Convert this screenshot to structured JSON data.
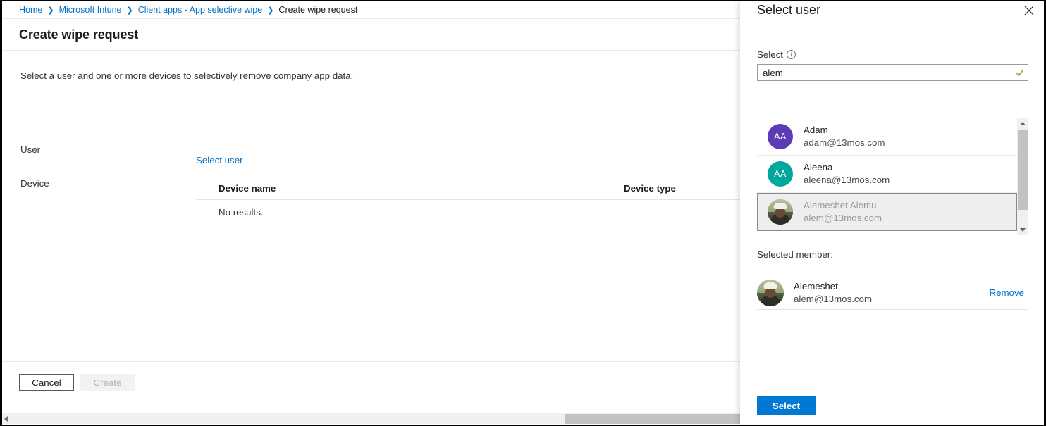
{
  "breadcrumb": {
    "items": [
      {
        "label": "Home",
        "link": true
      },
      {
        "label": "Microsoft Intune",
        "link": true
      },
      {
        "label": "Client apps - App selective wipe",
        "link": true
      },
      {
        "label": "Create wipe request",
        "link": false
      }
    ],
    "separator": "❯"
  },
  "blade": {
    "title": "Create wipe request",
    "intro": "Select a user and one or more devices to selectively remove company app data.",
    "user_label": "User",
    "select_user_link": "Select user",
    "device_label": "Device",
    "table": {
      "columns": [
        "Device name",
        "Device type"
      ],
      "empty_message": "No results."
    },
    "footer": {
      "cancel_label": "Cancel",
      "create_label": "Create"
    }
  },
  "panel": {
    "title": "Select user",
    "close_label": "✕",
    "select_label": "Select",
    "info_glyph": "i",
    "search": {
      "value": "alem",
      "placeholder": "",
      "valid": true
    },
    "results": [
      {
        "name": "Adam",
        "email": "adam@13mos.com",
        "initials": "AA",
        "avatar_type": "initials",
        "avatar_color": "#5c3bb5",
        "selected": false
      },
      {
        "name": "Aleena",
        "email": "aleena@13mos.com",
        "initials": "AA",
        "avatar_type": "initials",
        "avatar_color": "#00a79d",
        "selected": false
      },
      {
        "name": "Alemeshet Alemu",
        "email": "alem@13mos.com",
        "initials": "",
        "avatar_type": "photo",
        "avatar_color": "",
        "selected": true
      }
    ],
    "selected_member_label": "Selected member:",
    "selected_member": {
      "name": "Alemeshet",
      "email": "alem@13mos.com",
      "avatar_type": "photo",
      "remove_label": "Remove"
    },
    "footer": {
      "select_label": "Select"
    }
  },
  "colors": {
    "accent_blue": "#0078d4",
    "link_blue": "#0071c9",
    "valid_green": "#7fba42",
    "avatar_purple": "#5c3bb5",
    "avatar_teal": "#00a79d"
  }
}
